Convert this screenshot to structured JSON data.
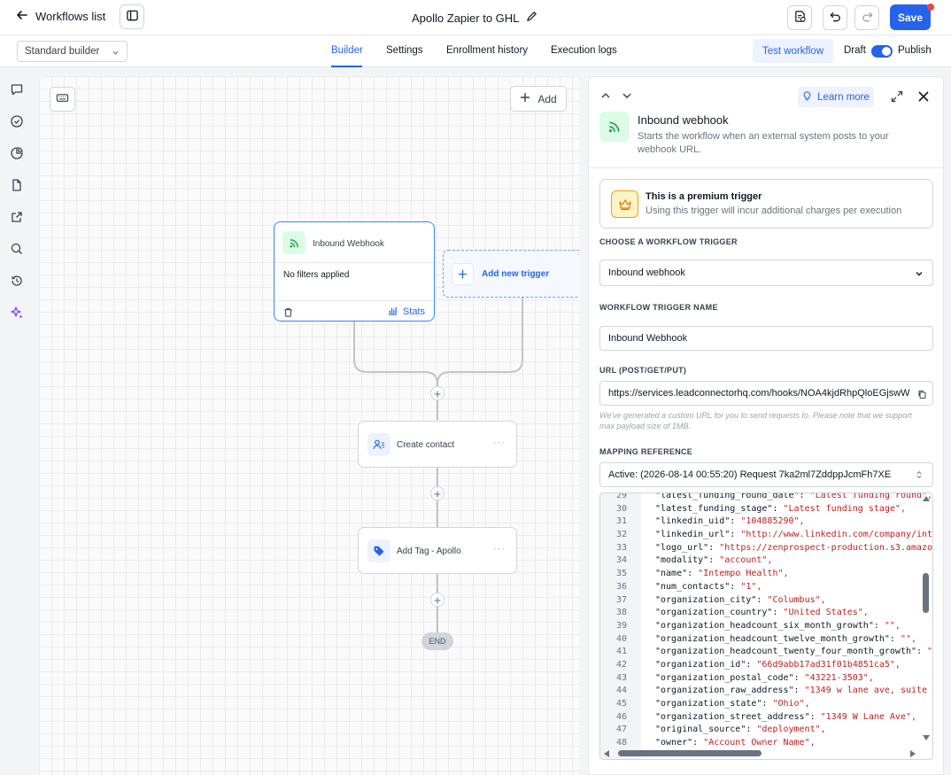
{
  "topbar": {
    "back_label": "Workflows list",
    "title": "Apollo Zapier to GHL",
    "save_label": "Save"
  },
  "subbar": {
    "builder_mode": "Standard builder",
    "tabs": [
      {
        "label": "Builder",
        "active": true
      },
      {
        "label": "Settings",
        "active": false
      },
      {
        "label": "Enrollment history",
        "active": false
      },
      {
        "label": "Execution logs",
        "active": false
      }
    ],
    "test_label": "Test workflow",
    "draft_label": "Draft",
    "publish_label": "Publish",
    "publish_on": true
  },
  "rail": {
    "icons": [
      "chat-icon",
      "check-circle-icon",
      "pie-chart-icon",
      "document-icon",
      "external-link-icon",
      "search-icon",
      "history-icon",
      "sparkles-icon"
    ]
  },
  "canvas": {
    "add_label": "Add",
    "trigger": {
      "name": "Inbound Webhook",
      "filters": "No filters applied",
      "stats_label": "Stats"
    },
    "new_trigger_label": "Add new trigger",
    "actions": [
      {
        "name": "Create contact",
        "icon": "contact-icon"
      },
      {
        "name": "Add Tag - Apollo",
        "icon": "tag-icon"
      }
    ],
    "end_label": "END"
  },
  "panel": {
    "learn_more": "Learn more",
    "trigger_name": "Inbound webhook",
    "trigger_desc": "Starts the workflow when an external system posts to your webhook URL.",
    "premium_title": "This is a premium trigger",
    "premium_desc": "Using this trigger will incur additional charges per execution",
    "choose_label": "CHOOSE A WORKFLOW TRIGGER",
    "choose_value": "Inbound webhook",
    "name_label": "WORKFLOW TRIGGER NAME",
    "name_value": "Inbound Webhook",
    "url_label": "URL (POST/GET/PUT)",
    "url_value": "https://services.leadconnectorhq.com/hooks/NOA4kjdRhpQloEGjswW",
    "url_hint": "We've generated a custom URL for you to send requests to. Please note that we support max payload size of 1MB.",
    "mapping_label": "MAPPING REFERENCE",
    "mapping_value": "Active: (2026-08-14 00:55:20) Request 7ka2ml7ZddppJcmFh7XE",
    "code_lines": [
      {
        "n": "29",
        "k": "\"latest_funding_round_date\": ",
        "v": "\"Latest funding round\","
      },
      {
        "n": "30",
        "k": "\"latest_funding_stage\": ",
        "v": "\"Latest funding stage\","
      },
      {
        "n": "31",
        "k": "\"linkedin_uid\": ",
        "v": "\"104885290\","
      },
      {
        "n": "32",
        "k": "\"linkedin_url\": ",
        "v": "\"http://www.linkedin.com/company/int"
      },
      {
        "n": "33",
        "k": "\"logo_url\": ",
        "v": "\"https://zenprospect-production.s3.amazo"
      },
      {
        "n": "34",
        "k": "\"modality\": ",
        "v": "\"account\","
      },
      {
        "n": "35",
        "k": "\"name\": ",
        "v": "\"Intempo Health\","
      },
      {
        "n": "36",
        "k": "\"num_contacts\": ",
        "v": "\"1\","
      },
      {
        "n": "37",
        "k": "\"organization_city\": ",
        "v": "\"Columbus\","
      },
      {
        "n": "38",
        "k": "\"organization_country\": ",
        "v": "\"United States\","
      },
      {
        "n": "39",
        "k": "\"organization_headcount_six_month_growth\": ",
        "v": "\"\","
      },
      {
        "n": "40",
        "k": "\"organization_headcount_twelve_month_growth\": ",
        "v": "\"\","
      },
      {
        "n": "41",
        "k": "\"organization_headcount_twenty_four_month_growth\": ",
        "v": "\""
      },
      {
        "n": "42",
        "k": "\"organization_id\": ",
        "v": "\"66d9abb17ad31f01b4851ca5\","
      },
      {
        "n": "43",
        "k": "\"organization_postal_code\": ",
        "v": "\"43221-3503\","
      },
      {
        "n": "44",
        "k": "\"organization_raw_address\": ",
        "v": "\"1349 w lane ave, suite"
      },
      {
        "n": "45",
        "k": "\"organization_state\": ",
        "v": "\"Ohio\","
      },
      {
        "n": "46",
        "k": "\"organization_street_address\": ",
        "v": "\"1349 W Lane Ave\","
      },
      {
        "n": "47",
        "k": "\"original_source\": ",
        "v": "\"deployment\","
      },
      {
        "n": "48",
        "k": "\"owner\": ",
        "v": "\"Account Owner Name\","
      }
    ]
  },
  "colors": {
    "accent": "#2563eb",
    "trigger_green": "#16a34a",
    "premium_amber": "#f59e0b",
    "code_value": "#c02020"
  }
}
